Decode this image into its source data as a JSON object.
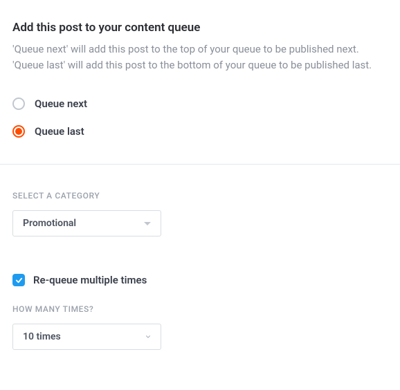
{
  "heading": "Add this post to your content queue",
  "description": "'Queue next' will add this post to the top of your queue to be published next. 'Queue last' will add this post to the bottom of your queue to be published last.",
  "radio": {
    "options": [
      {
        "label": "Queue next",
        "selected": false
      },
      {
        "label": "Queue last",
        "selected": true
      }
    ]
  },
  "category": {
    "label": "SELECT A CATEGORY",
    "selected": "Promotional"
  },
  "requeue": {
    "label": "Re-queue multiple times",
    "checked": true
  },
  "times": {
    "label": "HOW MANY TIMES?",
    "selected": "10 times"
  },
  "colors": {
    "accent_radio": "#ff4d00",
    "accent_checkbox": "#1e9bf0",
    "text_primary": "#2b2d33",
    "text_muted": "#8a8f99"
  }
}
